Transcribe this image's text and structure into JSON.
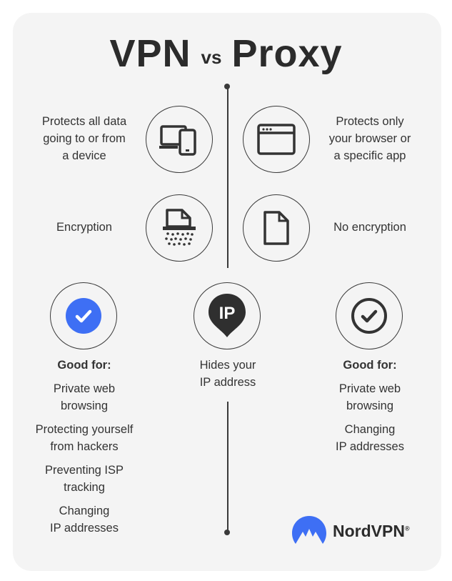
{
  "title": {
    "left": "VPN",
    "vs": "vs",
    "right": "Proxy"
  },
  "vpn": {
    "protects": [
      "Protects all data",
      "going to or from",
      "a device"
    ],
    "encryption": "Encryption",
    "good_for_heading": "Good for:",
    "good_for": [
      [
        "Private web",
        "browsing"
      ],
      [
        "Protecting yourself",
        "from hackers"
      ],
      [
        "Preventing ISP",
        "tracking"
      ],
      [
        "Changing",
        "IP addresses"
      ]
    ]
  },
  "proxy": {
    "protects": [
      "Protects only",
      "your browser or",
      "a specific app"
    ],
    "encryption": "No encryption",
    "good_for_heading": "Good for:",
    "good_for": [
      [
        "Private web",
        "browsing"
      ],
      [
        "Changing",
        "IP addresses"
      ]
    ]
  },
  "shared": {
    "ip_badge": "IP",
    "hides": [
      "Hides your",
      "IP address"
    ]
  },
  "brand": {
    "name": "NordVPN",
    "mark": "®"
  },
  "colors": {
    "accent": "#3e6ff4",
    "text": "#2f2f2f",
    "background": "#f4f4f4"
  }
}
